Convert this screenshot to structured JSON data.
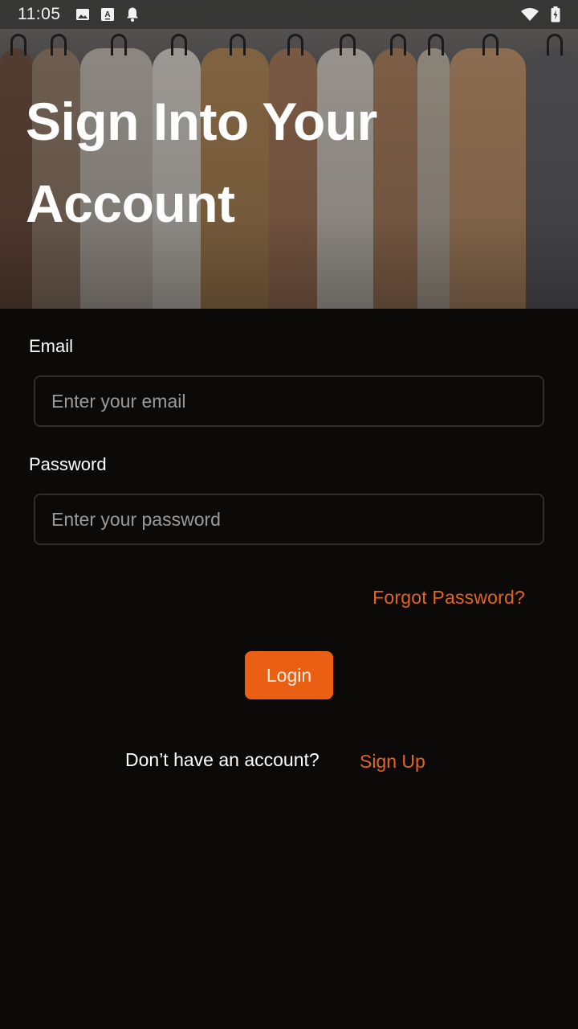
{
  "status_bar": {
    "time": "11:05",
    "left_icons": [
      "image-icon",
      "font-download-icon",
      "notification-bell-icon"
    ],
    "right_icons": [
      "wifi-icon",
      "battery-charging-icon"
    ]
  },
  "hero": {
    "title": "Sign Into Your Account",
    "background": "clothing-rack-photo"
  },
  "form": {
    "email": {
      "label": "Email",
      "value": "",
      "placeholder": "Enter your email"
    },
    "password": {
      "label": "Password",
      "value": "",
      "placeholder": "Enter your password"
    },
    "forgot_password_label": "Forgot Password?",
    "login_label": "Login",
    "signup_prompt": "Don’t have an account?",
    "signup_label": "Sign Up"
  },
  "colors": {
    "accent": "#ea5f12",
    "link": "#e4631e",
    "background": "#0b0a08",
    "input_border": "#2e2e2e",
    "placeholder": "#9a9a9a"
  }
}
